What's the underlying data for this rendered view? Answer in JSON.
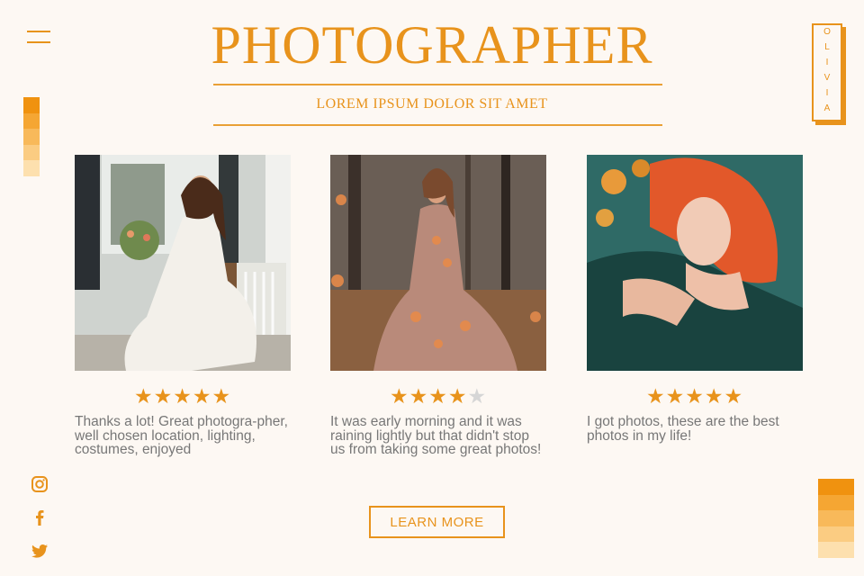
{
  "header": {
    "title": "PHOTOGRAPHER",
    "subtitle": "LOREM IPSUM DOLOR SIT AMET",
    "name_tag": "OLIVIA"
  },
  "colors": {
    "accent": "#e8931c",
    "background": "#fdf8f3",
    "text": "#777777",
    "swatches": [
      "#f0920f",
      "#f5a633",
      "#f8b95a",
      "#fbcc82",
      "#fde0ae"
    ]
  },
  "icons": {
    "menu": "hamburger-menu-icon",
    "social": [
      "instagram-icon",
      "facebook-icon",
      "twitter-icon"
    ]
  },
  "testimonials": [
    {
      "photo": "woman in white dress on porch chair",
      "rating": 5,
      "text": "Thanks a lot! Great photogra-pher, well chosen location, lighting, costumes, enjoyed"
    },
    {
      "photo": "woman in floral gown in autumn forest",
      "rating": 4,
      "text": "It was early morning and it was raining lightly but that didn't stop us from taking some great photos!"
    },
    {
      "photo": "red-haired woman lying among flowers",
      "rating": 5,
      "text": "I got photos, these are the best photos in my life!"
    }
  ],
  "cta": {
    "label": "LEARN MORE"
  }
}
